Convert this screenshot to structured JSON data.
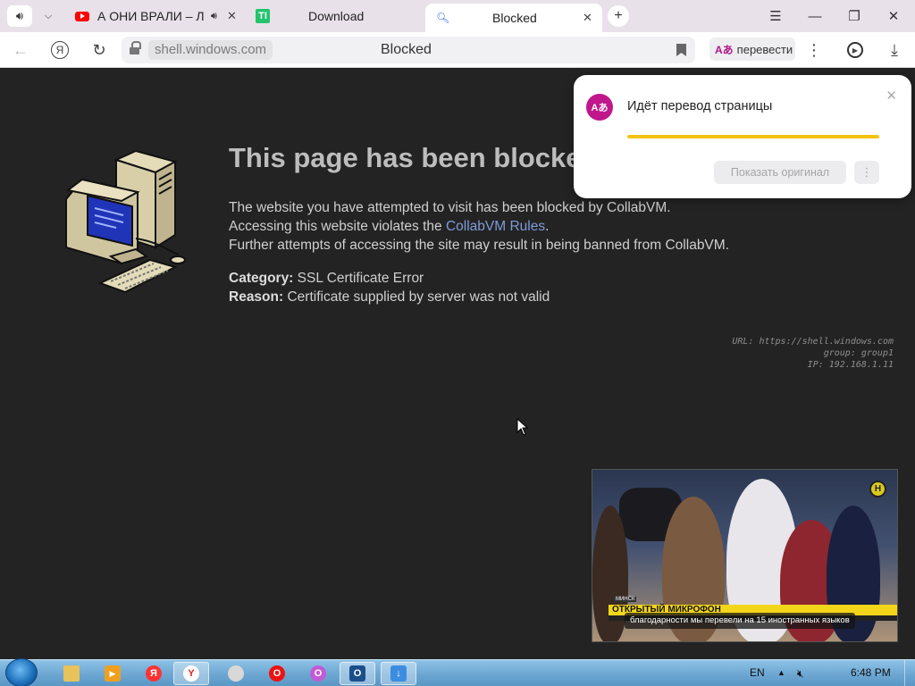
{
  "tabs": [
    {
      "title": "А ОНИ ВРАЛИ – ЛУ",
      "icon": "youtube-icon",
      "audio": true
    },
    {
      "title": "Download",
      "icon": "tl-site-icon",
      "badge": "TI"
    },
    {
      "title": "Blocked",
      "icon": "search-icon",
      "active": true
    }
  ],
  "address": {
    "domain": "shell.windows.com",
    "page_title": "Blocked",
    "translate_label": "перевести"
  },
  "page": {
    "title": "This page has been blocked",
    "line1": "The website you have attempted to visit has been blocked by CollabVM.",
    "line2_prefix": "Accessing this website violates the ",
    "rules_link": "CollabVM Rules",
    "line2_suffix": ".",
    "line3": "Further attempts of accessing the site may result in being banned from CollabVM.",
    "category_label": "Category:",
    "category_value": "SSL Certificate Error",
    "reason_label": "Reason:",
    "reason_value": "Certificate supplied by server was not valid",
    "meta_url": "URL: https://shell.windows.com",
    "meta_group": "group: group1",
    "meta_ip": "IP: 192.168.1.11"
  },
  "translate_popup": {
    "title": "Идёт перевод страницы",
    "progress": 1.0,
    "show_original": "Показать оригинал"
  },
  "video": {
    "city": "МИНСК",
    "ticker": "ОТКРЫТЫЙ МИКРОФОН",
    "subtitle": "благодарности мы перевели на 15 иностранных языков",
    "logo": "Н"
  },
  "taskbar": {
    "lang": "EN",
    "time": "6:48 PM"
  },
  "colors": {
    "tabbar": "#e9e1ea",
    "page_bg": "#232323",
    "link": "#7e9bd8",
    "accent_translate": "#c0178d",
    "progress": "#f2c40f"
  }
}
